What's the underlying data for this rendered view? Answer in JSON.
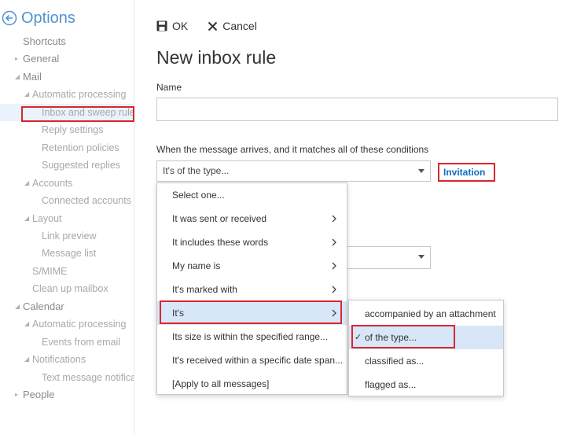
{
  "sidebar": {
    "title": "Options",
    "items": [
      {
        "label": "Shortcuts",
        "level": 0,
        "expander": ""
      },
      {
        "label": "General",
        "level": 0,
        "expander": "right"
      },
      {
        "label": "Mail",
        "level": 0,
        "expander": "down"
      },
      {
        "label": "Automatic processing",
        "level": 1,
        "expander": "down"
      },
      {
        "label": "Inbox and sweep rules",
        "level": 2,
        "expander": "",
        "selected": true
      },
      {
        "label": "Reply settings",
        "level": 2,
        "expander": ""
      },
      {
        "label": "Retention policies",
        "level": 2,
        "expander": ""
      },
      {
        "label": "Suggested replies",
        "level": 2,
        "expander": ""
      },
      {
        "label": "Accounts",
        "level": 1,
        "expander": "down"
      },
      {
        "label": "Connected accounts",
        "level": 2,
        "expander": ""
      },
      {
        "label": "Layout",
        "level": 1,
        "expander": "down"
      },
      {
        "label": "Link preview",
        "level": 2,
        "expander": ""
      },
      {
        "label": "Message list",
        "level": 2,
        "expander": ""
      },
      {
        "label": "S/MIME",
        "level": 1,
        "expander": ""
      },
      {
        "label": "Clean up mailbox",
        "level": 1,
        "expander": ""
      },
      {
        "label": "Calendar",
        "level": 0,
        "expander": "down"
      },
      {
        "label": "Automatic processing",
        "level": 1,
        "expander": "down"
      },
      {
        "label": "Events from email",
        "level": 2,
        "expander": ""
      },
      {
        "label": "Notifications",
        "level": 1,
        "expander": "down"
      },
      {
        "label": "Text message notifications",
        "level": 2,
        "expander": ""
      },
      {
        "label": "People",
        "level": 0,
        "expander": "right"
      }
    ]
  },
  "toolbar": {
    "ok_label": "OK",
    "cancel_label": "Cancel"
  },
  "page_title": "New inbox rule",
  "name_field": {
    "label": "Name",
    "value": ""
  },
  "conditions": {
    "label": "When the message arrives, and it matches all of these conditions",
    "selected_value": "It's of the type...",
    "value_link": "Invitation"
  },
  "condition_menu": {
    "items": [
      {
        "label": "Select one...",
        "has_submenu": false
      },
      {
        "label": "It was sent or received",
        "has_submenu": true
      },
      {
        "label": "It includes these words",
        "has_submenu": true
      },
      {
        "label": "My name is",
        "has_submenu": true
      },
      {
        "label": "It's marked with",
        "has_submenu": true
      },
      {
        "label": "It's",
        "has_submenu": true,
        "active": true
      },
      {
        "label": "Its size is within the specified range...",
        "has_submenu": false
      },
      {
        "label": "It's received within a specific date span...",
        "has_submenu": false
      },
      {
        "label": "[Apply to all messages]",
        "has_submenu": false
      }
    ]
  },
  "submenu": {
    "items": [
      {
        "label": "accompanied by an attachment",
        "checked": false
      },
      {
        "label": "of the type...",
        "checked": true
      },
      {
        "label": "classified as...",
        "checked": false
      },
      {
        "label": "flagged as...",
        "checked": false
      }
    ],
    "check_glyph": "✓"
  },
  "colors": {
    "accent": "#4f93d2",
    "highlight_border": "#d9262f",
    "link": "#0f6cbd",
    "menu_active": "#d7e7f7"
  }
}
